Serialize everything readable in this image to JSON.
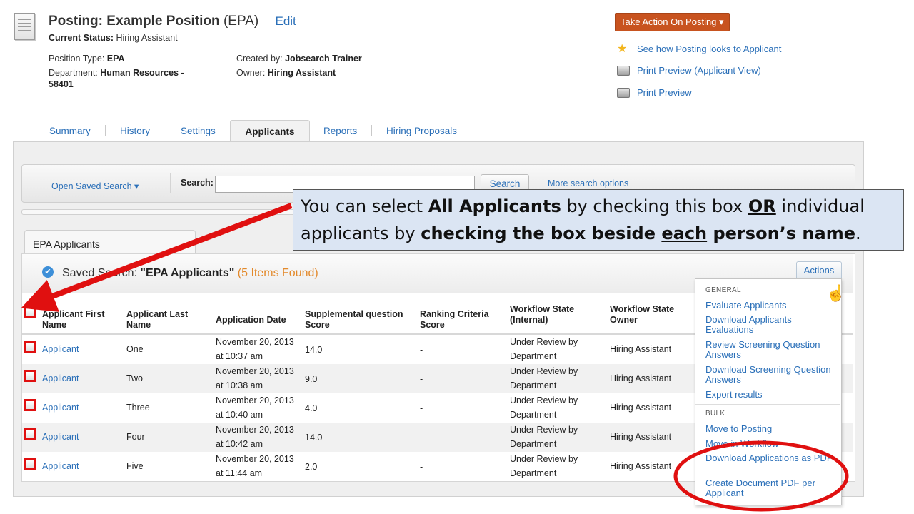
{
  "posting": {
    "title": "Posting: Example Position",
    "title_suffix": "(EPA)",
    "edit": "Edit",
    "current_status_label": "Current Status:",
    "current_status_value": "Hiring Assistant",
    "position_type_label": "Position Type:",
    "position_type_value": "EPA",
    "department_label": "Department:",
    "department_value": "Human Resources -",
    "department_value_2": "58401",
    "created_by_label": "Created by:",
    "created_by_value": "Jobsearch Trainer",
    "owner_label": "Owner:",
    "owner_value": "Hiring Assistant"
  },
  "right_actions": {
    "take_action": "Take Action On Posting ▾",
    "see_how": "See how Posting looks to Applicant",
    "print_preview_applicant": "Print Preview (Applicant View)",
    "print_preview": "Print Preview"
  },
  "tabs": [
    "Summary",
    "History",
    "Settings",
    "Applicants",
    "Reports",
    "Hiring Proposals"
  ],
  "search": {
    "open_saved": "Open Saved Search ▾",
    "label": "Search:",
    "value": "",
    "button": "Search",
    "more": "More search options"
  },
  "saved_search": {
    "tab_label": "EPA Applicants",
    "prefix": "Saved Search:",
    "name": "\"EPA Applicants\"",
    "count": "(5 Items Found)",
    "actions": "Actions"
  },
  "table": {
    "columns": [
      "Applicant First Name",
      "Applicant Last Name",
      "Application Date",
      "Supplemental question Score",
      "Ranking Criteria Score",
      "Workflow State (Internal)",
      "Workflow State Owner"
    ],
    "rows": [
      {
        "first": "Applicant",
        "last": "One",
        "date1": "November 20, 2013",
        "date2": "at 10:37 am",
        "supp": "14.0",
        "rank": "-",
        "state1": "Under Review by",
        "state2": "Department",
        "owner": "Hiring Assistant"
      },
      {
        "first": "Applicant",
        "last": "Two",
        "date1": "November 20, 2013",
        "date2": "at 10:38 am",
        "supp": "9.0",
        "rank": "-",
        "state1": "Under Review by",
        "state2": "Department",
        "owner": "Hiring Assistant"
      },
      {
        "first": "Applicant",
        "last": "Three",
        "date1": "November 20, 2013",
        "date2": "at 10:40 am",
        "supp": "4.0",
        "rank": "-",
        "state1": "Under Review by",
        "state2": "Department",
        "owner": "Hiring Assistant"
      },
      {
        "first": "Applicant",
        "last": "Four",
        "date1": "November 20, 2013",
        "date2": "at 10:42 am",
        "supp": "14.0",
        "rank": "-",
        "state1": "Under Review by",
        "state2": "Department",
        "owner": "Hiring Assistant"
      },
      {
        "first": "Applicant",
        "last": "Five",
        "date1": "November 20, 2013",
        "date2": "at 11:44 am",
        "supp": "2.0",
        "rank": "-",
        "state1": "Under Review by",
        "state2": "Department",
        "owner": "Hiring Assistant"
      }
    ]
  },
  "actions_menu": {
    "general": "GENERAL",
    "general_items": [
      "Evaluate Applicants",
      "Download Applicants Evaluations",
      "Review Screening Question Answers",
      "Download Screening Question Answers",
      "Export results"
    ],
    "bulk": "BULK",
    "bulk_items": [
      "Move to Posting",
      "Move in Workflow",
      "Download Applications as PDF",
      "Create Document PDF per Applicant"
    ]
  },
  "callout": {
    "t1": "You can select ",
    "t2": "All Applicants",
    "t3": " by checking this box ",
    "t4": "OR",
    "t5": " individual applicants by ",
    "t6": "checking the box beside ",
    "t7": "each",
    "t8": " person’s name",
    "t9": "."
  },
  "colors": {
    "link": "#2a6fb8",
    "take_action": "#c8531f",
    "annotation": "#e01010",
    "callout_bg": "#dbe5f3",
    "count": "#e38a2c"
  }
}
